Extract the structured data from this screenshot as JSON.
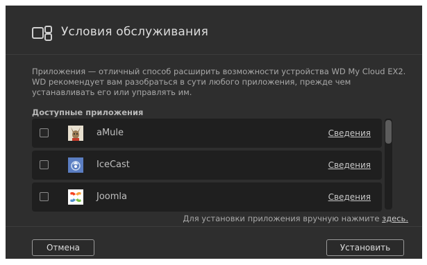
{
  "dialog": {
    "title": "Условия обслуживания",
    "description": "Приложения — отличный способ расширить возможности устройства WD My Cloud EX2. WD рекомендует вам разобраться в сути любого приложения, прежде чем устанавливать его или управлять им.",
    "section_label": "Доступные приложения",
    "apps": [
      {
        "name": "aMule",
        "details": "Сведения",
        "icon": "amule-icon",
        "checked": false
      },
      {
        "name": "IceCast",
        "details": "Сведения",
        "icon": "icecast-icon",
        "checked": false
      },
      {
        "name": "Joomla",
        "details": "Сведения",
        "icon": "joomla-icon",
        "checked": false
      }
    ],
    "manual_install_text": "Для установки приложения вручную нажмите",
    "manual_install_link": "здесь.",
    "cancel_label": "Отмена",
    "install_label": "Установить"
  },
  "colors": {
    "background": "#2e2e2e",
    "row_background": "#1f1f1f",
    "text": "#dcdcdc"
  }
}
